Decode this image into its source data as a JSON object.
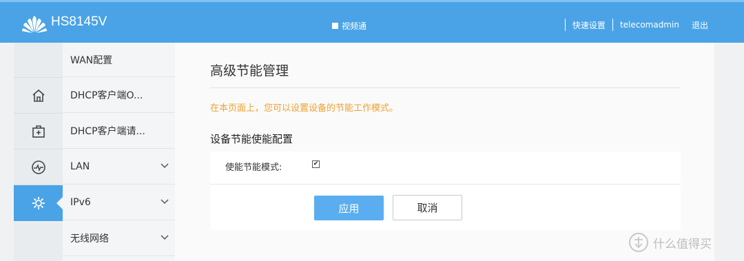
{
  "header": {
    "model": "HS8145V",
    "video_label": "视频通",
    "nav": [
      "快速设置",
      "telecomadmin",
      "退出"
    ]
  },
  "icons": [
    "home-icon",
    "first-aid-icon",
    "activity-icon",
    "gear-icon"
  ],
  "submenu": [
    {
      "label": "WAN配置",
      "chevron": false
    },
    {
      "label": "DHCP客户端O...",
      "chevron": false
    },
    {
      "label": "DHCP客户端请...",
      "chevron": false
    },
    {
      "label": "LAN",
      "chevron": true
    },
    {
      "label": "IPv6",
      "chevron": true
    },
    {
      "label": "无线网络",
      "chevron": true
    }
  ],
  "main": {
    "title": "高级节能管理",
    "notice": "在本页面上，您可以设置设备的节能工作模式。",
    "section_title": "设备节能使能配置",
    "enable_label": "使能节能模式:",
    "enable_checked": true,
    "apply_label": "应用",
    "cancel_label": "取消"
  },
  "watermark": "什么值得买",
  "colors": {
    "header": "#4aa3e6",
    "notice": "#f0a133",
    "apply": "#5aaef0"
  }
}
